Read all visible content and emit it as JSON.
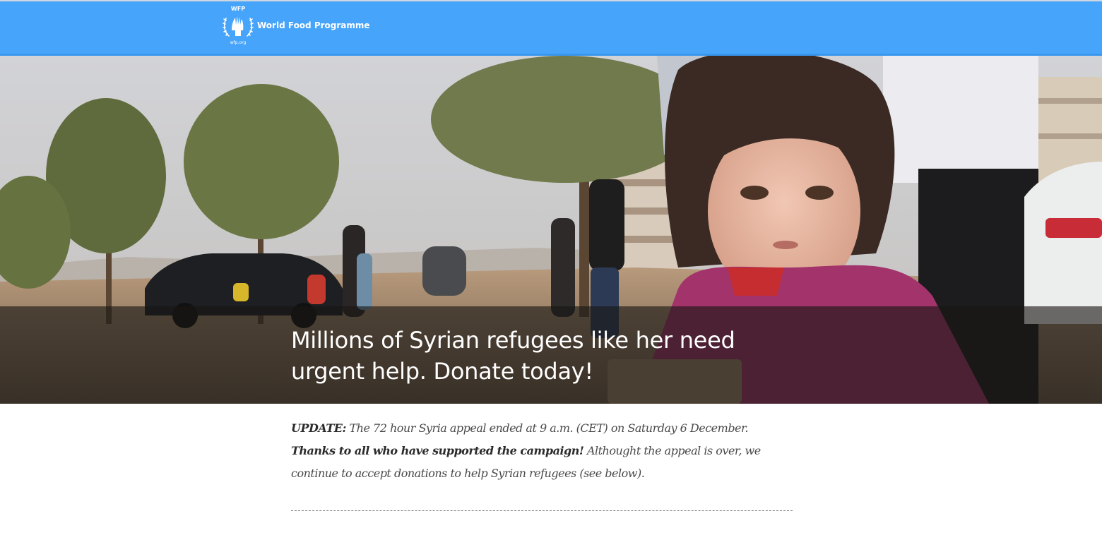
{
  "header": {
    "logo_top": "WFP",
    "logo_bottom": "wfp.org",
    "brand_name": "World Food Programme",
    "icon": "wfp-emblem-icon",
    "background": "#47a4fb"
  },
  "hero": {
    "title": "Millions of Syrian refugees like her need urgent help. Donate today!",
    "image": "girl-in-pink-jacket-photo"
  },
  "update": {
    "label": "UPDATE:",
    "line1": " The 72 hour Syria appeal ended at 9 a.m. (CET) on Saturday 6 December.",
    "thanks": "Thanks to all who have supported the campaign!",
    "line2": " Althought the appeal is over, we continue to accept donations to help Syrian refugees (see below)."
  }
}
